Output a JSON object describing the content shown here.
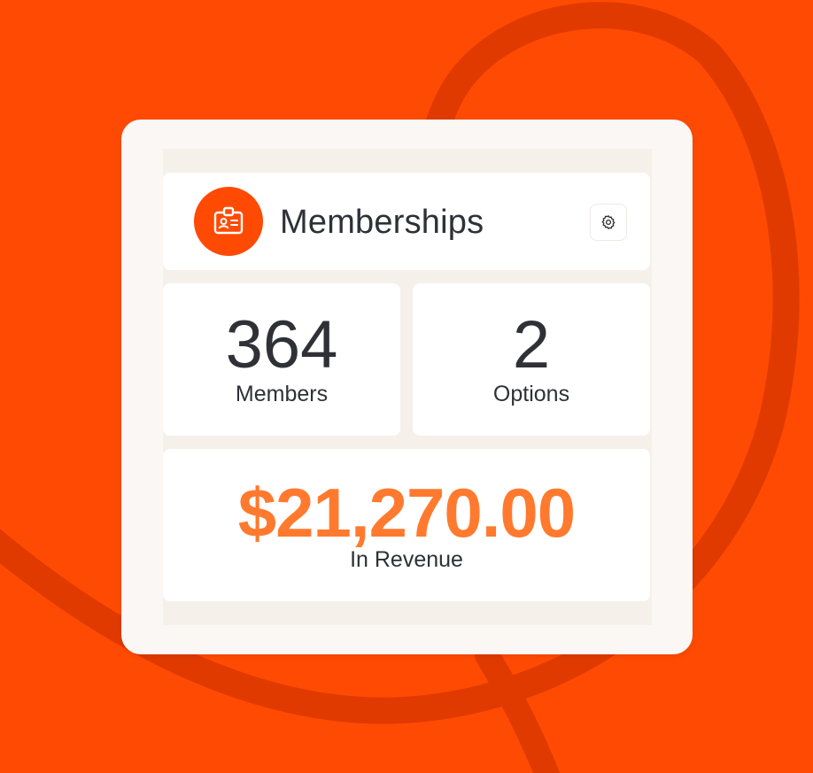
{
  "colors": {
    "background": "#ff4a03",
    "accent": "#ff4a03",
    "revenue": "#ff7a2e",
    "text": "#2f3137"
  },
  "widget": {
    "title": "Memberships",
    "icon": "id-badge-icon",
    "settings_icon": "gear-icon",
    "members": {
      "value": "364",
      "label": "Members"
    },
    "options": {
      "value": "2",
      "label": "Options"
    },
    "revenue": {
      "value": "$21,270.00",
      "label": "In Revenue"
    }
  }
}
